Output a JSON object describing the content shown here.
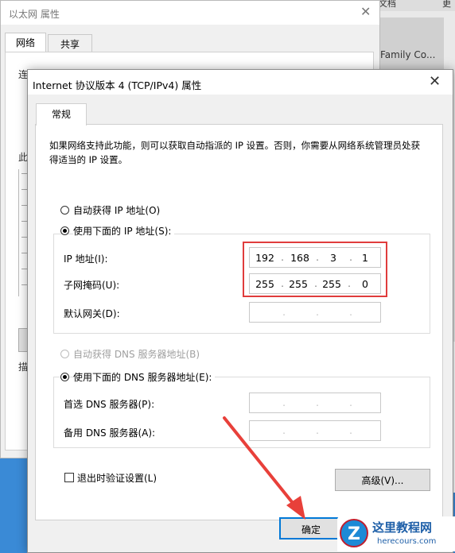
{
  "background": {
    "top_right_text": "文档",
    "top_right_text2": "更",
    "tile_text": "Family Co..."
  },
  "back_dialog": {
    "title": "以太网 属性",
    "close_glyph": "✕",
    "tabs": [
      "网络",
      "共享"
    ],
    "frag1": "连",
    "frag2": "此",
    "frag3": "描"
  },
  "dialog": {
    "title": "Internet 协议版本 4 (TCP/IPv4) 属性",
    "close_glyph": "✕",
    "tab_general": "常规",
    "description": "如果网络支持此功能，则可以获取自动指派的 IP 设置。否则，你需要从网络系统管理员处获得适当的 IP 设置。",
    "ip": {
      "auto_label": "自动获得 IP 地址(O)",
      "auto_selected": false,
      "manual_label": "使用下面的 IP 地址(S):",
      "manual_selected": true,
      "address_label": "IP 地址(I):",
      "address": [
        "192",
        "168",
        "3",
        "1"
      ],
      "subnet_label": "子网掩码(U):",
      "subnet": [
        "255",
        "255",
        "255",
        "0"
      ],
      "gateway_label": "默认网关(D):",
      "gateway": [
        "",
        "",
        "",
        ""
      ]
    },
    "dns": {
      "auto_label": "自动获得 DNS 服务器地址(B)",
      "auto_enabled": false,
      "manual_label": "使用下面的 DNS 服务器地址(E):",
      "manual_selected": true,
      "preferred_label": "首选 DNS 服务器(P):",
      "preferred": [
        "",
        "",
        "",
        ""
      ],
      "alternate_label": "备用 DNS 服务器(A):",
      "alternate": [
        "",
        "",
        "",
        ""
      ]
    },
    "validate_label": "退出时验证设置(L)",
    "validate_checked": false,
    "advanced_button": "高级(V)...",
    "ok_button": "确定",
    "dot_char": ".",
    "colors": {
      "highlight": "#e03c3c",
      "arrow": "#e8403a",
      "primary_border": "#0078d7"
    }
  },
  "watermark": {
    "logo_char": "Z",
    "name": "这里教程网",
    "url": "herecours.com"
  }
}
